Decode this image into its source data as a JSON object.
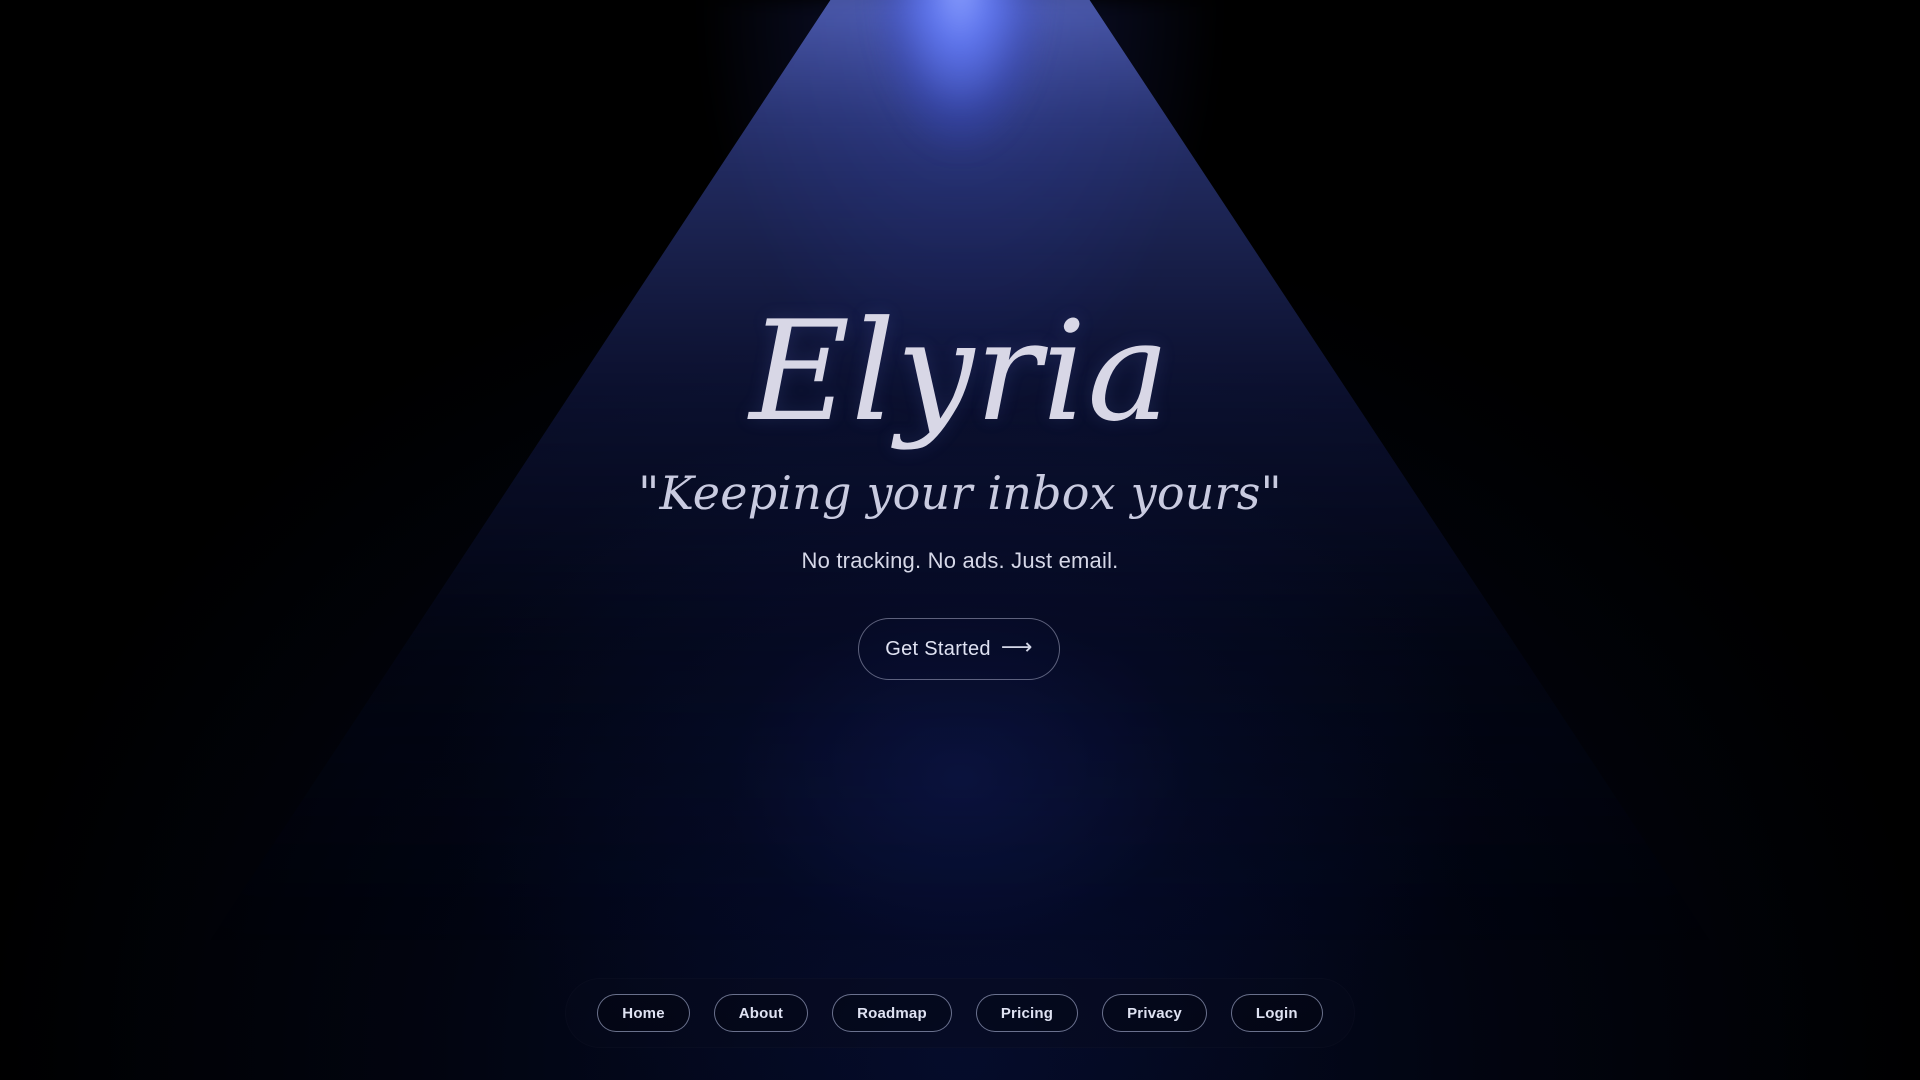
{
  "hero": {
    "brand": "Elyria",
    "tagline": "\"Keeping your inbox yours\"",
    "subtext": "No tracking. No ads. Just email.",
    "cta": {
      "label": "Get Started",
      "icon": "arrow-right-icon"
    }
  },
  "nav": {
    "items": [
      {
        "label": "Home"
      },
      {
        "label": "About"
      },
      {
        "label": "Roadmap"
      },
      {
        "label": "Pricing"
      },
      {
        "label": "Privacy"
      },
      {
        "label": "Login"
      }
    ]
  },
  "colors": {
    "background": "#000000",
    "beam": "#6f86ff",
    "text": "#d7d9e6",
    "pill_border": "#bec6eb"
  }
}
